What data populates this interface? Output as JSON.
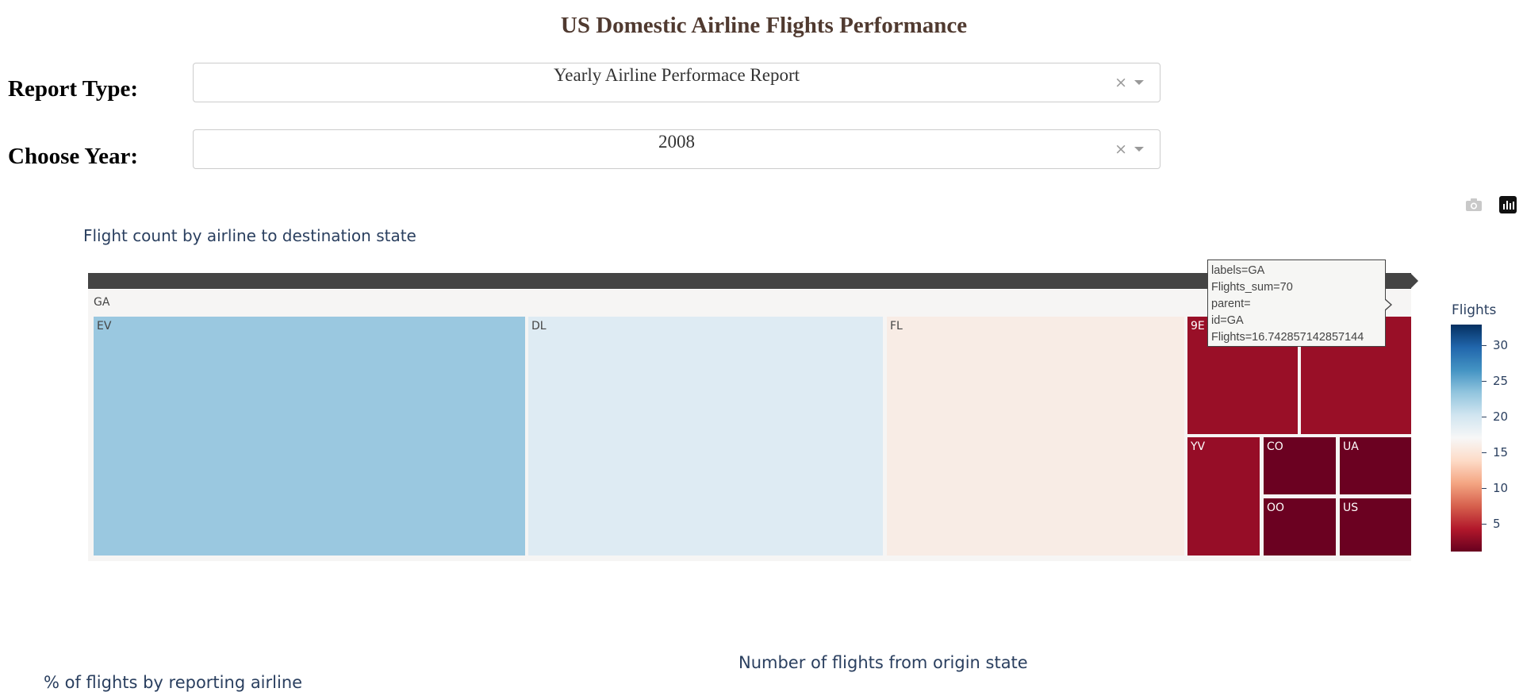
{
  "header": {
    "title": "US Domestic Airline Flights Performance"
  },
  "controls": {
    "report_type": {
      "label": "Report Type:",
      "value": "Yearly Airline Performace Report",
      "clear": "×"
    },
    "year": {
      "label": "Choose Year:",
      "value": "2008",
      "clear": "×"
    }
  },
  "modebar": {
    "icons": [
      "camera-icon",
      "plotly-logo-icon"
    ]
  },
  "treemap": {
    "title": "Flight count by airline to destination state",
    "root_label": "GA",
    "cells": [
      {
        "label": "EV"
      },
      {
        "label": "DL"
      },
      {
        "label": "FL"
      },
      {
        "label": "9E"
      },
      {
        "label": ""
      },
      {
        "label": "YV"
      },
      {
        "label": "CO"
      },
      {
        "label": "UA"
      },
      {
        "label": "OO"
      },
      {
        "label": "US"
      }
    ],
    "tooltip": {
      "lines": [
        "labels=GA",
        "Flights_sum=70",
        "parent=",
        "id=GA",
        "Flights=16.742857142857144"
      ]
    },
    "colorbar": {
      "title": "Flights",
      "ticks": [
        "30",
        "25",
        "20",
        "15",
        "10",
        "5"
      ]
    }
  },
  "subplots": {
    "origin_title": "Number of flights from origin state",
    "airline_title": "% of flights by reporting airline"
  }
}
